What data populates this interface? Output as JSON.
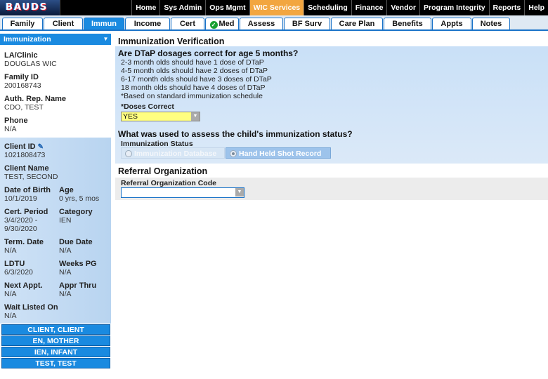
{
  "logo": {
    "text": "BAUDS"
  },
  "topnav": {
    "items": [
      "Home",
      "Sys Admin",
      "Ops Mgmt",
      "WIC Services",
      "Scheduling",
      "Finance",
      "Vendor",
      "Program Integrity",
      "Reports",
      "Help"
    ],
    "active": "WIC Services"
  },
  "tabs": [
    "Family",
    "Client",
    "Immun",
    "Income",
    "Cert",
    "Med",
    "Assess",
    "BF Surv",
    "Care Plan",
    "Benefits",
    "Appts",
    "Notes"
  ],
  "active_tab": "Immun",
  "left_panel": {
    "header": "Immunization",
    "la_clinic_label": "LA/Clinic",
    "la_clinic_value": "DOUGLAS WIC",
    "family_id_label": "Family ID",
    "family_id_value": "200168743",
    "auth_rep_label": "Auth. Rep. Name",
    "auth_rep_value": "CDO, TEST",
    "phone_label": "Phone",
    "phone_value": "N/A",
    "client_id_label": "Client ID",
    "client_id_value": "1021808473",
    "client_name_label": "Client Name",
    "client_name_value": "TEST, SECOND",
    "dob_label": "Date of Birth",
    "dob_value": "10/1/2019",
    "age_label": "Age",
    "age_value": "0 yrs, 5 mos",
    "cert_period_label": "Cert. Period",
    "cert_period_value_1": "3/4/2020 -",
    "cert_period_value_2": "9/30/2020",
    "category_label": "Category",
    "category_value": "IEN",
    "term_date_label": "Term. Date",
    "term_date_value": "N/A",
    "due_date_label": "Due Date",
    "due_date_value": "N/A",
    "ldtu_label": "LDTU",
    "ldtu_value": "6/3/2020",
    "weeks_pg_label": "Weeks PG",
    "weeks_pg_value": "N/A",
    "next_appt_label": "Next Appt.",
    "next_appt_value": "N/A",
    "appr_thru_label": "Appr Thru",
    "appr_thru_value": "N/A",
    "wait_listed_label": "Wait Listed On",
    "wait_listed_value": "N/A",
    "family_members": [
      "CLIENT, CLIENT",
      "EN, MOTHER",
      "IEN, INFANT",
      "TEST, TEST"
    ]
  },
  "main": {
    "title": "Immunization Verification",
    "question1": "Are DTaP dosages correct for age 5 months?",
    "rules": [
      "2-3 month olds should have 1 dose of DTaP",
      "4-5 month olds should have 2 doses of DTaP",
      "6-17 month olds should have 3 doses of DTaP",
      "18 month olds should have 4 doses of DTaP",
      "*Based on standard immunization schedule"
    ],
    "doses_label": "*Doses Correct",
    "doses_value": "YES",
    "question2": "What was used to assess the child's immunization status?",
    "status_label": "Immunization Status",
    "status_options": [
      "Immunization Database",
      "Hand Held Shot Record"
    ],
    "referral_title": "Referral Organization",
    "referral_code_label": "Referral Organization Code",
    "referral_code_value": ""
  },
  "colors": {
    "accent": "#1a8ae0",
    "active_nav": "#f2a640",
    "select_highlight": "#ffff80"
  }
}
